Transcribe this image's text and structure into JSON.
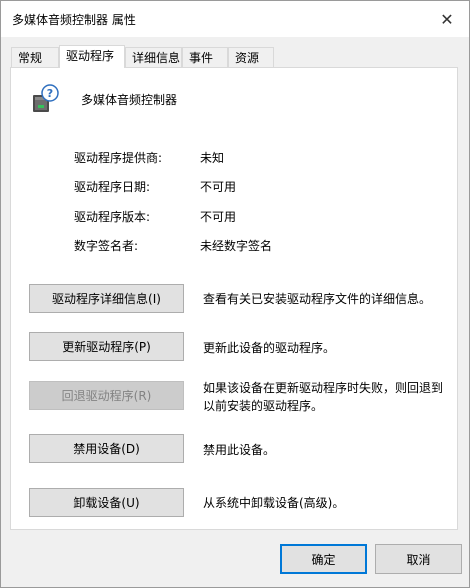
{
  "window": {
    "title": "多媒体音频控制器 属性"
  },
  "tabs": [
    {
      "label": "常规"
    },
    {
      "label": "驱动程序"
    },
    {
      "label": "详细信息"
    },
    {
      "label": "事件"
    },
    {
      "label": "资源"
    }
  ],
  "active_tab": "驱动程序",
  "device": {
    "name": "多媒体音频控制器",
    "icon": "unknown-device-icon"
  },
  "driver_info": [
    {
      "label": "驱动程序提供商:",
      "value": "未知"
    },
    {
      "label": "驱动程序日期:",
      "value": "不可用"
    },
    {
      "label": "驱动程序版本:",
      "value": "不可用"
    },
    {
      "label": "数字签名者:",
      "value": "未经数字签名"
    }
  ],
  "actions": [
    {
      "label": "驱动程序详细信息(I)",
      "description": "查看有关已安装驱动程序文件的详细信息。",
      "enabled": true
    },
    {
      "label": "更新驱动程序(P)",
      "description": "更新此设备的驱动程序。",
      "enabled": true
    },
    {
      "label": "回退驱动程序(R)",
      "description": "如果该设备在更新驱动程序时失败，则回退到以前安装的驱动程序。",
      "enabled": false
    },
    {
      "label": "禁用设备(D)",
      "description": "禁用此设备。",
      "enabled": true
    },
    {
      "label": "卸载设备(U)",
      "description": "从系统中卸载设备(高级)。",
      "enabled": true
    }
  ],
  "footer": {
    "ok_label": "确定",
    "cancel_label": "取消"
  },
  "colors": {
    "default_button_border": "#0078d7",
    "disabled_button_bg": "#cccccc"
  }
}
